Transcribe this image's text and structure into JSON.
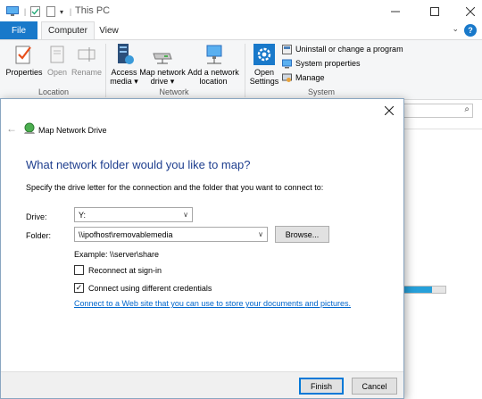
{
  "window": {
    "title": "This PC"
  },
  "ribbon": {
    "tabs": [
      "File",
      "Computer",
      "View"
    ],
    "groups": {
      "location": {
        "label": "Location",
        "buttons": [
          "Properties",
          "Open",
          "Rename"
        ]
      },
      "network": {
        "label": "Network",
        "access_media": {
          "line1": "Access",
          "line2": "media ▾"
        },
        "map_network_drive": {
          "line1": "Map network",
          "line2": "drive ▾"
        },
        "add_network_location": {
          "line1": "Add a network",
          "line2": "location"
        }
      },
      "system": {
        "label": "System",
        "open_settings": {
          "line1": "Open",
          "line2": "Settings"
        },
        "items": [
          "Uninstall or change a program",
          "System properties",
          "Manage"
        ]
      }
    }
  },
  "background": {
    "progress_fraction": 0.68
  },
  "dialog": {
    "title": "Map Network Drive",
    "heading": "What network folder would you like to map?",
    "instructions": "Specify the drive letter for the connection and the folder that you want to connect to:",
    "drive_label": "Drive:",
    "drive_value": "Y:",
    "folder_label": "Folder:",
    "folder_value": "\\\\ipofhost\\removablemedia",
    "browse_label": "Browse...",
    "example": "Example: \\\\server\\share",
    "reconnect_label": "Reconnect at sign-in",
    "reconnect_checked": false,
    "credentials_label": "Connect using different credentials",
    "credentials_checked": true,
    "link": "Connect to a Web site that you can use to store your documents and pictures.",
    "finish_label": "Finish",
    "cancel_label": "Cancel"
  },
  "colors": {
    "accent": "#1979ca",
    "heading": "#1e3e8e",
    "link": "#0066cc"
  }
}
